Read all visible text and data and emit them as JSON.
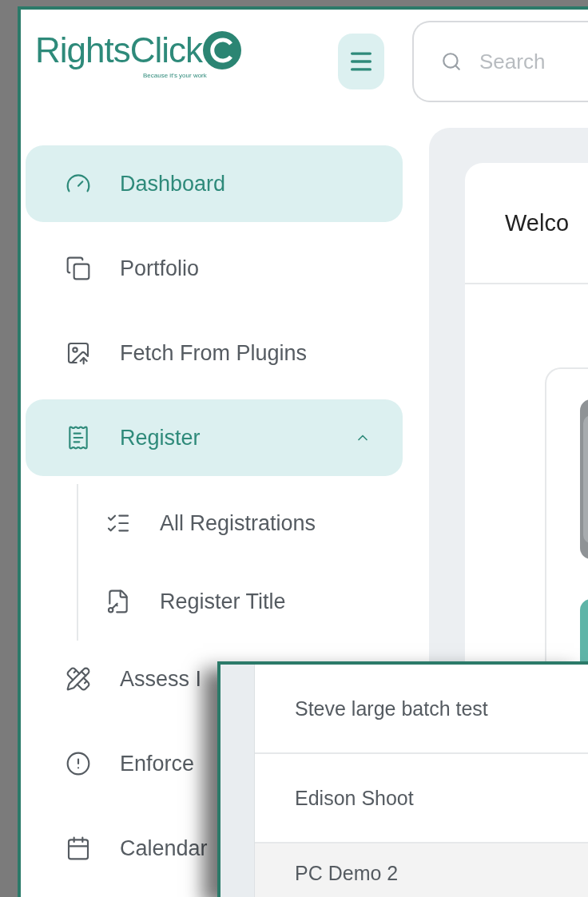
{
  "header": {
    "logo": {
      "name": "RightsClick",
      "tagline": "Because it's your work"
    },
    "search": {
      "placeholder": "Search"
    }
  },
  "sidebar": {
    "items": [
      {
        "kind": "dashboard",
        "label": "Dashboard",
        "selected": true
      },
      {
        "kind": "portfolio",
        "label": "Portfolio",
        "selected": false
      },
      {
        "kind": "fetch",
        "label": "Fetch From Plugins",
        "selected": false
      },
      {
        "kind": "register",
        "label": "Register",
        "selected": true,
        "expanded": true,
        "children": [
          {
            "kind": "list",
            "label": "All Registrations",
            "selected": false
          },
          {
            "kind": "title",
            "label": "Register Title",
            "selected": false
          }
        ]
      },
      {
        "kind": "assess",
        "label": "Assess I",
        "selected": false
      },
      {
        "kind": "enforce",
        "label": "Enforce",
        "selected": false
      },
      {
        "kind": "calendar",
        "label": "Calendar",
        "selected": false
      }
    ]
  },
  "main": {
    "card_title": "Welco"
  },
  "overlay": {
    "rows": [
      {
        "label": "Steve large batch test",
        "selected": false
      },
      {
        "label": "Edison Shoot",
        "selected": false
      },
      {
        "label": "PC Demo 2",
        "selected": true
      }
    ]
  }
}
